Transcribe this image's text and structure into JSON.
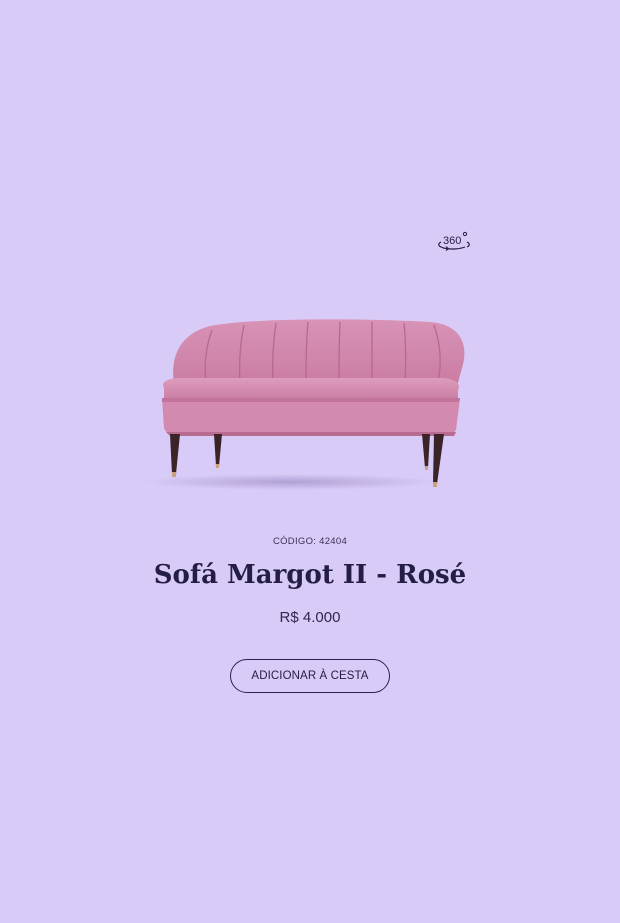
{
  "product": {
    "code_label": "CÓDIGO: 42404",
    "title": "Sofá Margot II - Rosé",
    "price": "R$ 4.000",
    "add_to_cart_label": "ADICIONAR À CESTA",
    "view_360_label": "360°",
    "image_icon": "pink-loveseat-sofa"
  },
  "colors": {
    "background": "#d9cbf7",
    "text": "#241d45",
    "sofa": "#d58eb0",
    "legs": "#3a2428"
  }
}
